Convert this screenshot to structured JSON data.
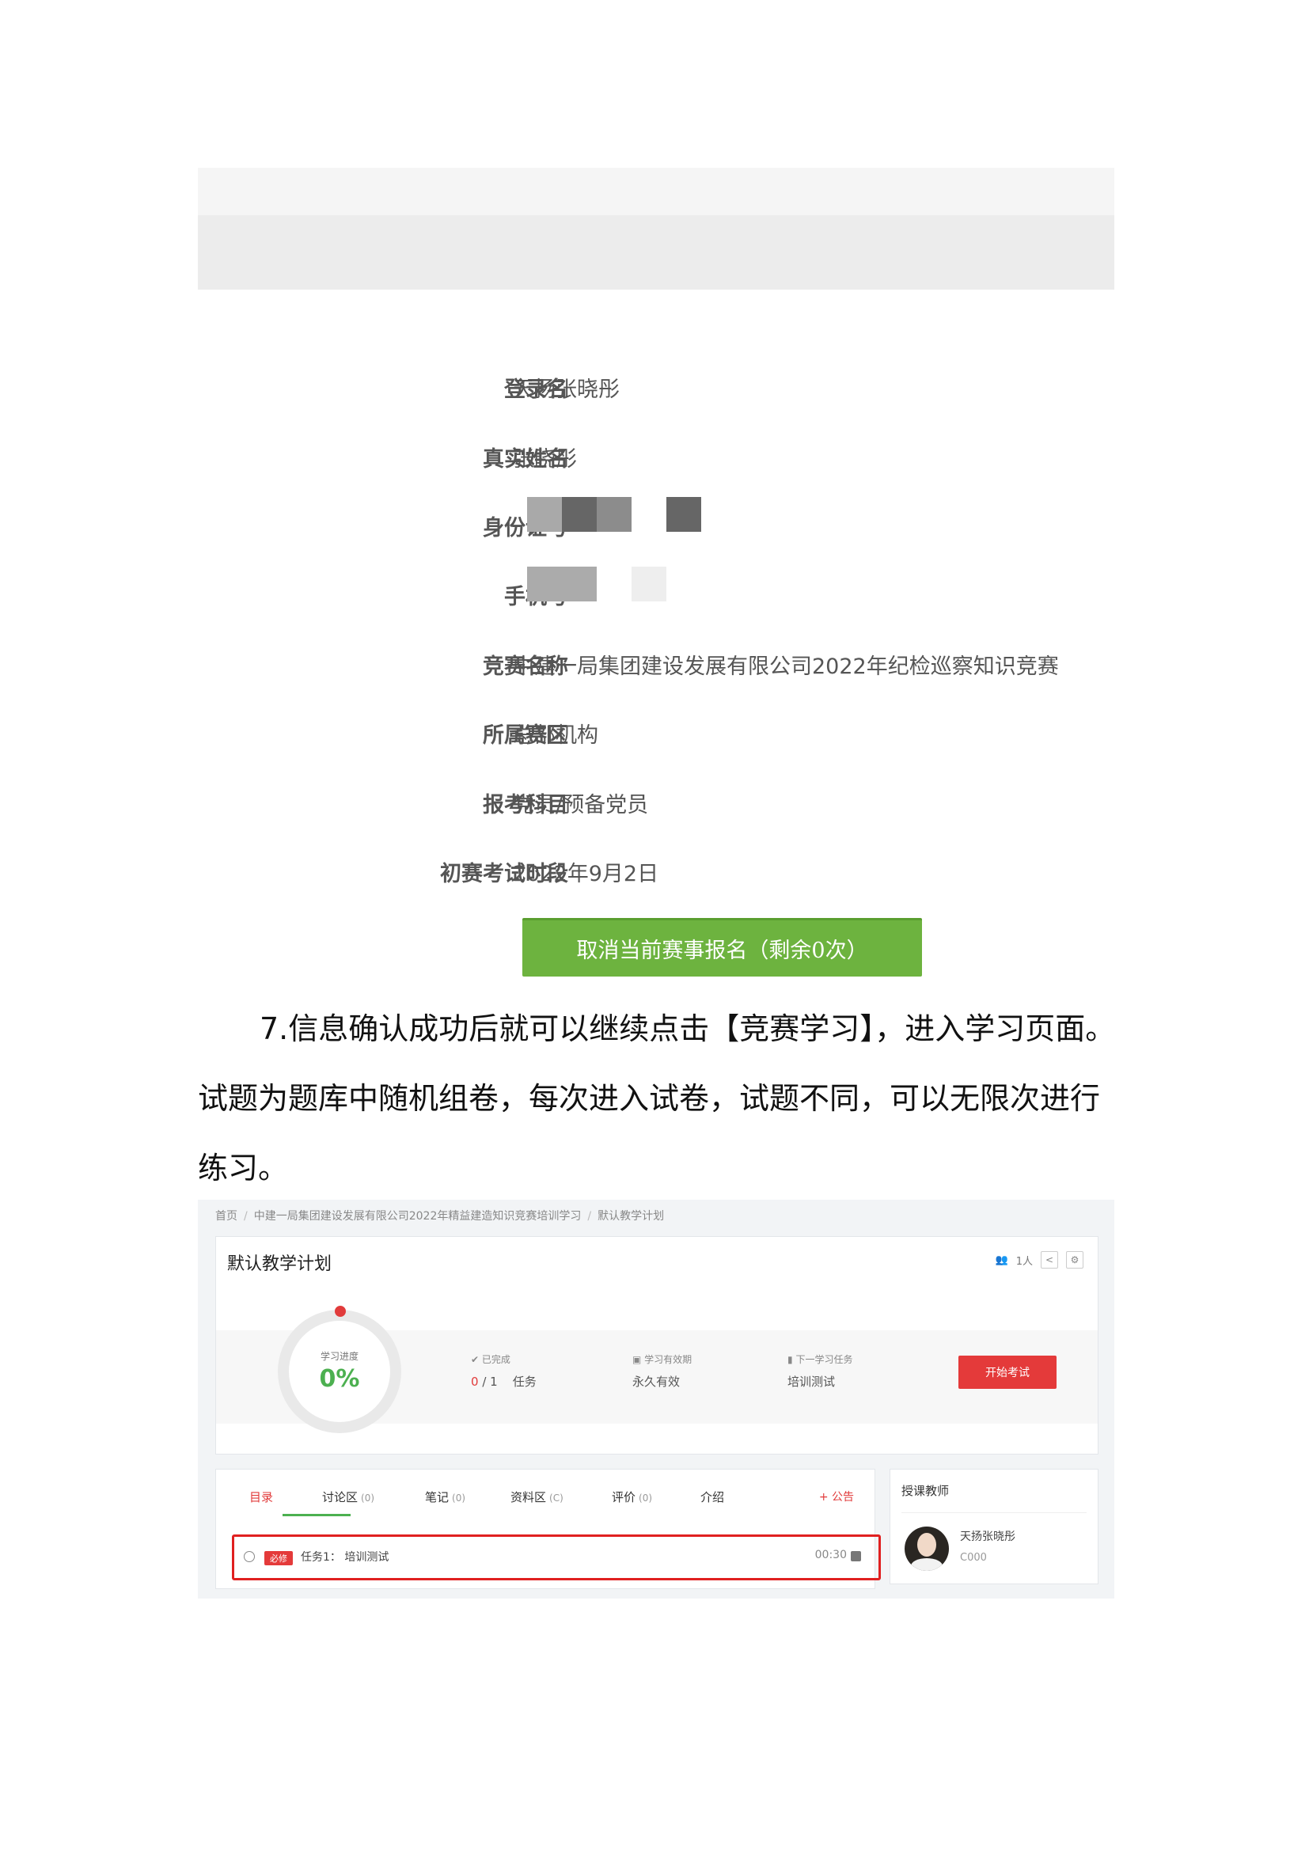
{
  "registration": {
    "rows": [
      {
        "label": "登录名",
        "value": "天扬张晓彤"
      },
      {
        "label": "真实姓名",
        "value": "张晓彤"
      },
      {
        "label": "身份证号",
        "value": ""
      },
      {
        "label": "手机号",
        "value": ""
      },
      {
        "label": "竞赛名称",
        "value": "中建一局集团建设发展有限公司2022年纪检巡察知识竞赛"
      },
      {
        "label": "所属赛区",
        "value": "总部机构"
      },
      {
        "label": "报考科目",
        "value": "党员/预备党员"
      },
      {
        "label": "初赛考试时段",
        "value": "2022年9月2日"
      }
    ],
    "cancel_button": "取消当前赛事报名（剩余0次）"
  },
  "paragraph": {
    "line1": "7.信息确认成功后就可以继续点击【竞赛学习】，进入学习页面。",
    "line2": "试题为题库中随机组卷，每次进入试卷，试题不同，可以无限次进行",
    "line3": "练习。"
  },
  "learning_page": {
    "breadcrumb": [
      "首页",
      "中建一局集团建设发展有限公司2022年精益建造知识竞赛培训学习",
      "默认教学计划"
    ],
    "plan_title": "默认教学计划",
    "member_count": "1人",
    "progress": {
      "label": "学习进度",
      "value": "0%"
    },
    "stats": {
      "completed_label": "已完成",
      "completed_done": "0",
      "completed_total": "/ 1",
      "completed_unit": "任务",
      "validity_label": "学习有效期",
      "validity_value": "永久有效",
      "next_label": "下一学习任务",
      "next_value": "培训测试"
    },
    "start_button": "开始考试",
    "tabs": [
      {
        "label": "目录",
        "count": ""
      },
      {
        "label": "讨论区",
        "count": "(0)"
      },
      {
        "label": "笔记",
        "count": "(0)"
      },
      {
        "label": "资料区",
        "count": "(C)"
      },
      {
        "label": "评价",
        "count": "(0)"
      },
      {
        "label": "介绍",
        "count": ""
      }
    ],
    "notice": "+ 公告",
    "task": {
      "tag": "必修",
      "text": "任务1：  培训测试",
      "time": "00:30"
    },
    "teacher": {
      "title": "授课教师",
      "name": "天扬张晓彤",
      "code": "C000"
    }
  },
  "colors": {
    "green_button": "#6db33f",
    "red_button": "#e43a3a",
    "progress_green": "#4cb050",
    "highlight_red": "#e02020"
  }
}
